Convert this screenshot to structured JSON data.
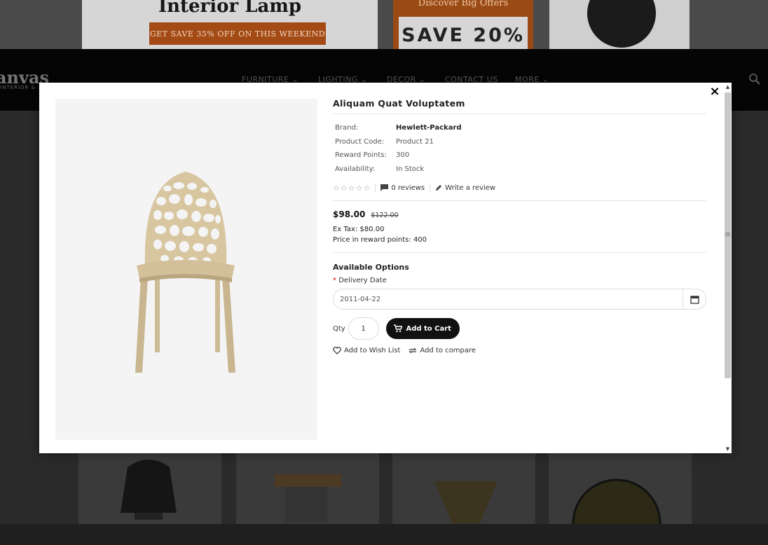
{
  "background": {
    "banner_left": {
      "title": "Interior Lamp",
      "cta": "GET SAVE 35% OFF ON THIS WEEKEND"
    },
    "banner_mid": {
      "subtitle": "Discover Big Offers",
      "offer": "SAVE 20%"
    },
    "logo": "anvas",
    "logo_tagline": "INTERIOR & ...",
    "nav": [
      "FURNITURE ⌄",
      "LIGHTING ⌄",
      "DECOR ⌄",
      "CONTACT US",
      "MORE ⌄"
    ]
  },
  "modal": {
    "close_label": "×",
    "product": {
      "title": "Aliquam Quat Voluptatem",
      "specs": [
        {
          "label": "Brand:",
          "value": "Hewlett-Packard"
        },
        {
          "label": "Product Code:",
          "value": "Product 21"
        },
        {
          "label": "Reward Points:",
          "value": "300"
        },
        {
          "label": "Availability:",
          "value": "In Stock"
        }
      ],
      "stars": "☆☆☆☆☆",
      "reviews": "0 reviews",
      "write_review": "Write a review",
      "price": "$98.00",
      "old_price": "$122.00",
      "ex_tax": "Ex Tax: $80.00",
      "reward_price": "Price in reward points: 400",
      "options_title": "Available Options",
      "delivery_label": "Delivery Date",
      "required_mark": "*",
      "delivery_value": "2011-04-22",
      "qty_label": "Qty",
      "qty_value": "1",
      "add_to_cart": "Add to Cart",
      "wishlist": "Add to Wish List",
      "compare": "Add to compare"
    }
  }
}
